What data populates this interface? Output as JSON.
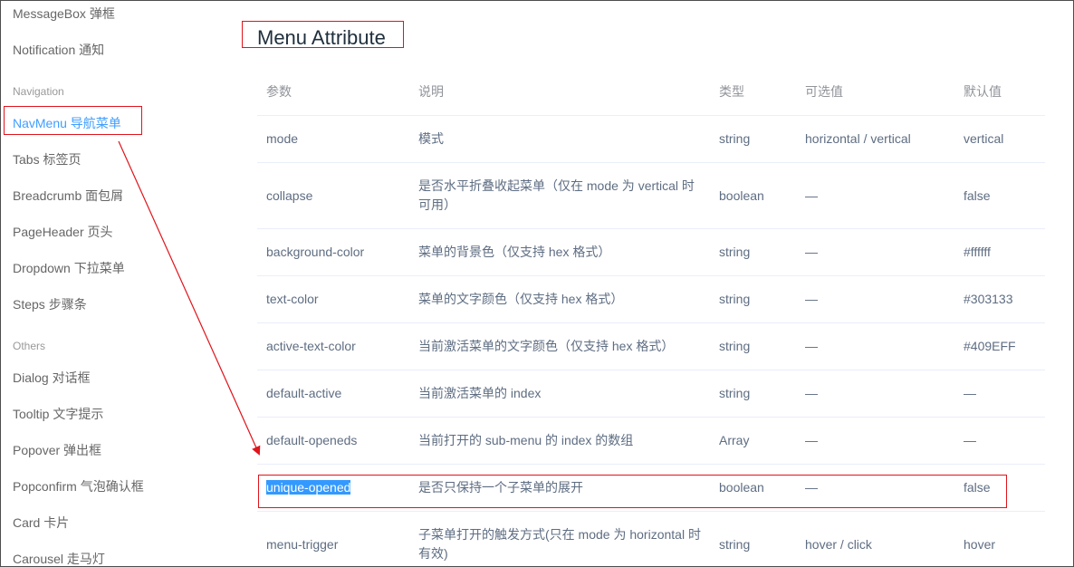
{
  "sidebar": {
    "items_top": [
      "MessageBox 弹框",
      "Notification 通知"
    ],
    "group_navigation": "Navigation",
    "nav_items": [
      "NavMenu 导航菜单",
      "Tabs 标签页",
      "Breadcrumb 面包屑",
      "PageHeader 页头",
      "Dropdown 下拉菜单",
      "Steps 步骤条"
    ],
    "group_others": "Others",
    "other_items": [
      "Dialog 对话框",
      "Tooltip 文字提示",
      "Popover 弹出框",
      "Popconfirm 气泡确认框",
      "Card 卡片",
      "Carousel 走马灯"
    ],
    "active_item": "NavMenu 导航菜单",
    "active_color": "#409EFF"
  },
  "main": {
    "title": "Menu Attribute",
    "headers": [
      "参数",
      "说明",
      "类型",
      "可选值",
      "默认值"
    ],
    "rows": [
      {
        "param": "mode",
        "desc": "模式",
        "type": "string",
        "options": "horizontal / vertical",
        "default": "vertical"
      },
      {
        "param": "collapse",
        "desc": "是否水平折叠收起菜单（仅在 mode 为 vertical 时可用）",
        "type": "boolean",
        "options": "—",
        "default": "false"
      },
      {
        "param": "background-color",
        "desc": "菜单的背景色（仅支持 hex 格式）",
        "type": "string",
        "options": "—",
        "default": "#ffffff"
      },
      {
        "param": "text-color",
        "desc": "菜单的文字颜色（仅支持 hex 格式）",
        "type": "string",
        "options": "—",
        "default": "#303133"
      },
      {
        "param": "active-text-color",
        "desc": "当前激活菜单的文字颜色（仅支持 hex 格式）",
        "type": "string",
        "options": "—",
        "default": "#409EFF"
      },
      {
        "param": "default-active",
        "desc": "当前激活菜单的 index",
        "type": "string",
        "options": "—",
        "default": "—"
      },
      {
        "param": "default-openeds",
        "desc": "当前打开的 sub-menu 的 index 的数组",
        "type": "Array",
        "options": "—",
        "default": "—"
      },
      {
        "param": "unique-opened",
        "desc": "是否只保持一个子菜单的展开",
        "type": "boolean",
        "options": "—",
        "default": "false"
      },
      {
        "param": "menu-trigger",
        "desc": "子菜单打开的触发方式(只在 mode 为 horizontal 时有效)",
        "type": "string",
        "options": "hover / click",
        "default": "hover"
      }
    ],
    "selected_param": "unique-opened"
  },
  "annotation_color": "#e0141c"
}
